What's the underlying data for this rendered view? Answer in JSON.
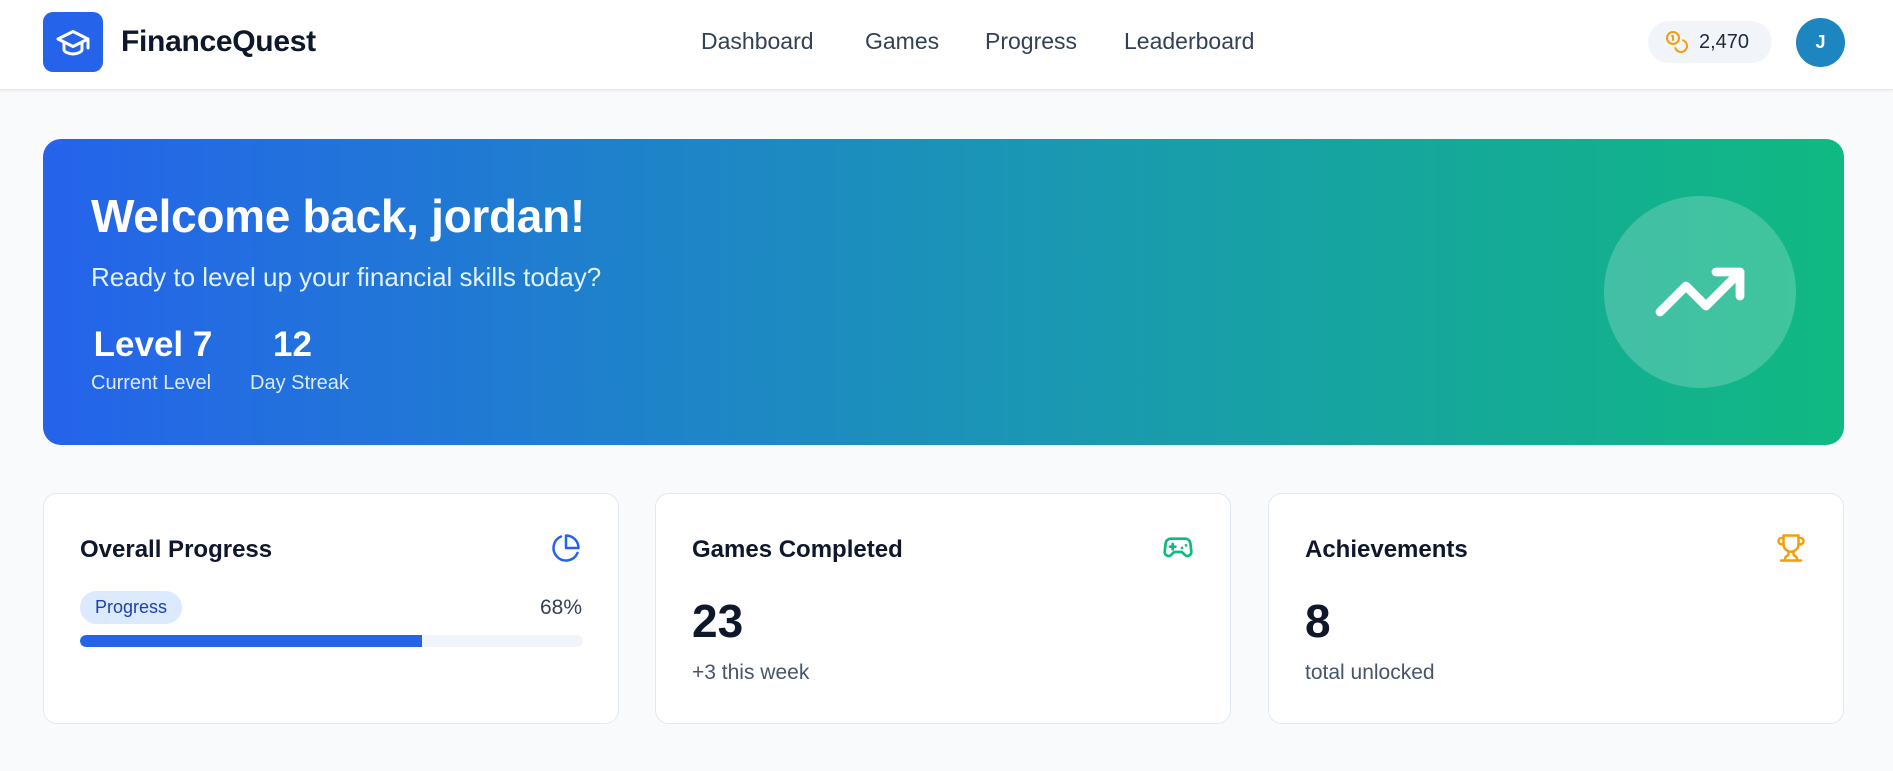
{
  "header": {
    "brand": "FinanceQuest",
    "nav": [
      "Dashboard",
      "Games",
      "Progress",
      "Leaderboard"
    ],
    "coins": "2,470",
    "avatar_initial": "J"
  },
  "hero": {
    "title": "Welcome back, jordan!",
    "subtitle": "Ready to level up your financial skills today?",
    "stats": [
      {
        "value": "Level 7",
        "label": "Current Level"
      },
      {
        "value": "12",
        "label": "Day Streak"
      }
    ],
    "icon": "trending-up-icon"
  },
  "cards": {
    "progress": {
      "title": "Overall Progress",
      "icon": "pie-chart-icon",
      "pill": "Progress",
      "percent_label": "68%",
      "percent": 68
    },
    "games": {
      "title": "Games Completed",
      "icon": "gamepad-icon",
      "value": "23",
      "note": "+3 this week"
    },
    "achievements": {
      "title": "Achievements",
      "icon": "trophy-icon",
      "value": "8",
      "note": "total unlocked"
    }
  },
  "colors": {
    "primary": "#2563eb",
    "accent_green": "#10b981",
    "coin": "#f59e0b",
    "trophy": "#f59e0b"
  }
}
